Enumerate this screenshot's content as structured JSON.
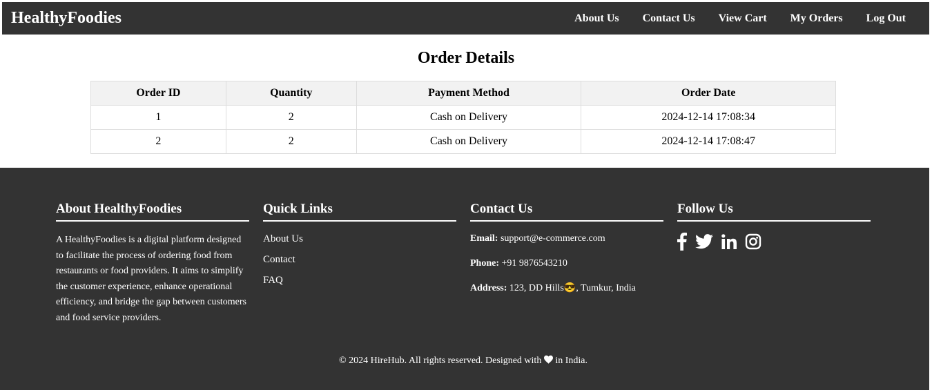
{
  "nav": {
    "brand": "HealthyFoodies",
    "links": [
      "About Us",
      "Contact Us",
      "View Cart",
      "My Orders",
      "Log Out"
    ]
  },
  "main": {
    "title": "Order Details",
    "table": {
      "headers": [
        "Order ID",
        "Quantity",
        "Payment Method",
        "Order Date"
      ],
      "rows": [
        [
          "1",
          "2",
          "Cash on Delivery",
          "2024-12-14 17:08:34"
        ],
        [
          "2",
          "2",
          "Cash on Delivery",
          "2024-12-14 17:08:47"
        ]
      ]
    }
  },
  "footer": {
    "about": {
      "heading": "About HealthyFoodies",
      "text": "A HealthyFoodies is a digital platform designed to facilitate the process of ordering food from restaurants or food providers. It aims to simplify the customer experience, enhance operational efficiency, and bridge the gap between customers and food service providers."
    },
    "quick_links": {
      "heading": "Quick Links",
      "items": [
        "About Us",
        "Contact",
        "FAQ"
      ]
    },
    "contact": {
      "heading": "Contact Us",
      "email_label": "Email:",
      "email": "support@e-commerce.com",
      "phone_label": "Phone:",
      "phone": "+91 9876543210",
      "address_label": "Address:",
      "address_before": "123, DD Hills",
      "address_emoji": "😎",
      "address_after": ", Tumkur, India"
    },
    "follow": {
      "heading": "Follow Us",
      "icons": [
        "facebook-icon",
        "twitter-icon",
        "linkedin-icon",
        "instagram-icon"
      ]
    },
    "copyright_before": "© 2024 HireHub. All rights reserved. Designed with",
    "copyright_after": "in India."
  },
  "colors": {
    "navbar_bg": "#333333",
    "footer_bg": "#333333",
    "table_header_bg": "#f2f2f2",
    "table_border": "#dddddd"
  }
}
